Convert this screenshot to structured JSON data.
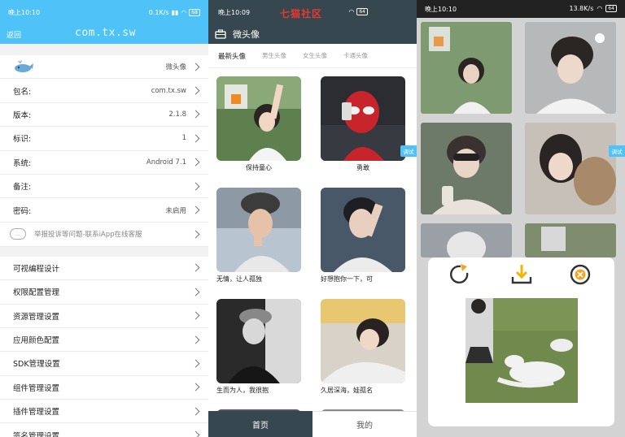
{
  "panel1": {
    "status": {
      "time": "晚上10:10",
      "speed": "0.1K/s",
      "battery": "68"
    },
    "header": {
      "back": "返回",
      "title": "com.tx.sw"
    },
    "app_name": "微头像",
    "info_rows": [
      {
        "label": "包名:",
        "value": "com.tx.sw"
      },
      {
        "label": "版本:",
        "value": "2.1.8"
      },
      {
        "label": "标识:",
        "value": "1"
      },
      {
        "label": "系统:",
        "value": "Android 7.1"
      },
      {
        "label": "备注:",
        "value": ""
      },
      {
        "label": "密码:",
        "value": "未启用"
      }
    ],
    "report": {
      "icon_text": "...",
      "text": "举报投诉等问题-联系iApp在线客服"
    },
    "menu": [
      "可视编程设计",
      "权限配置管理",
      "资源管理设置",
      "应用颜色配置",
      "SDK管理设置",
      "组件管理设置",
      "插件管理设置",
      "签名管理设置"
    ]
  },
  "panel2": {
    "status": {
      "time": "晚上10:09",
      "watermark": "七猫社区",
      "battery": "64"
    },
    "header": {
      "title": "微头像"
    },
    "tabs": [
      "最新头像",
      "男生头像",
      "女生头像",
      "卡通头像"
    ],
    "cards": [
      {
        "caption": "保持童心"
      },
      {
        "caption": "勇敢"
      },
      {
        "caption": "无情，让人孤独"
      },
      {
        "caption": "好想抱你一下，可"
      },
      {
        "caption": "生而为人，我很抱"
      },
      {
        "caption": "久居深海，娃孤名"
      }
    ],
    "debug_label": "调试",
    "bottom_nav": {
      "home": "首页",
      "mine": "我的"
    }
  },
  "panel3": {
    "status": {
      "time": "晚上10:10",
      "speed": "13.8K/s",
      "battery": "64"
    },
    "debug_label": "调试",
    "dialog": {
      "icons": [
        "share-icon",
        "download-icon",
        "close-icon"
      ]
    }
  },
  "colors": {
    "accent_blue": "#4fc3f7",
    "dark_slate": "#37474f",
    "download_yellow": "#f5b400",
    "close_orange": "#f5a623"
  }
}
